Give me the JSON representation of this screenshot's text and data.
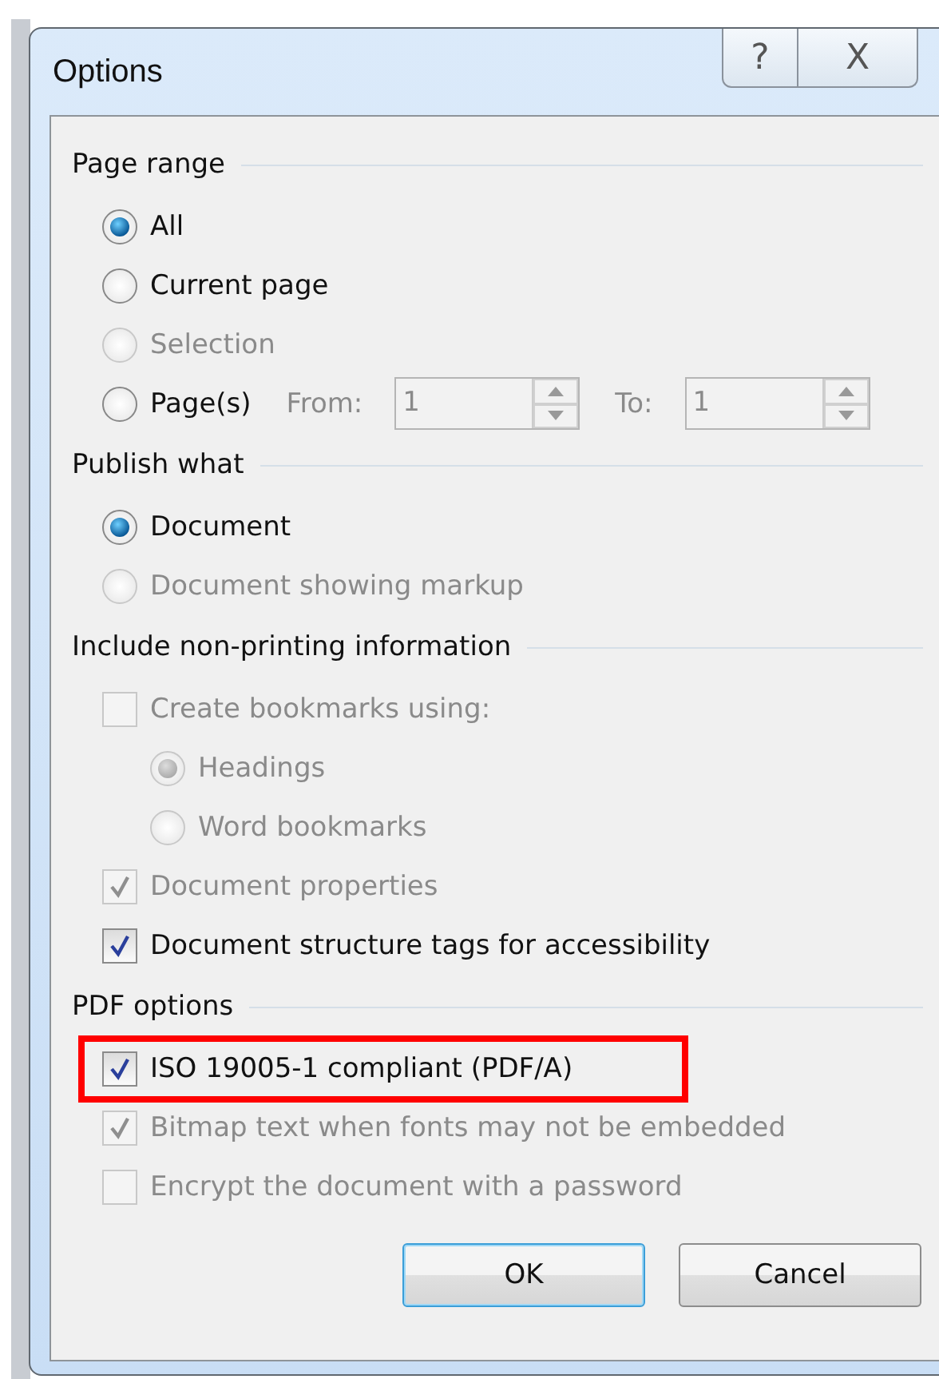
{
  "window": {
    "title": "Options",
    "caption_buttons": [
      "?",
      "X"
    ]
  },
  "sections": [
    {
      "title": "Page range",
      "items": [
        {
          "kind": "radio",
          "label": "All",
          "selected": true,
          "disabled": false
        },
        {
          "kind": "radio",
          "label": "Current page",
          "selected": false,
          "disabled": false
        },
        {
          "kind": "radio",
          "label": "Selection",
          "selected": false,
          "disabled": true
        },
        {
          "kind": "pages",
          "label": "Page(s)",
          "selected": false,
          "disabled": false,
          "from_label": "From:",
          "from_value": "1",
          "to_label": "To:",
          "to_value": "1"
        }
      ]
    },
    {
      "title": "Publish what",
      "items": [
        {
          "kind": "radio",
          "label": "Document",
          "selected": true,
          "disabled": false
        },
        {
          "kind": "radio",
          "label": "Document showing markup",
          "selected": false,
          "disabled": true
        }
      ]
    },
    {
      "title": "Include non-printing information",
      "items": [
        {
          "kind": "checkbox",
          "label": "Create bookmarks using:",
          "checked": false,
          "disabled": true,
          "children": [
            {
              "kind": "radio",
              "label": "Headings",
              "selected": true,
              "disabled": true
            },
            {
              "kind": "radio",
              "label": "Word bookmarks",
              "selected": false,
              "disabled": true
            }
          ]
        },
        {
          "kind": "checkbox",
          "label": "Document properties",
          "checked": true,
          "disabled": true
        },
        {
          "kind": "checkbox",
          "label": "Document structure tags for accessibility",
          "checked": true,
          "disabled": false
        }
      ]
    },
    {
      "title": "PDF options",
      "items": [
        {
          "kind": "checkbox",
          "label": "ISO 19005-1 compliant (PDF/A)",
          "checked": true,
          "disabled": false,
          "highlighted": true
        },
        {
          "kind": "checkbox",
          "label": "Bitmap text when fonts may not be embedded",
          "checked": true,
          "disabled": true
        },
        {
          "kind": "checkbox",
          "label": "Encrypt the document with a password",
          "checked": false,
          "disabled": true
        }
      ]
    }
  ],
  "buttons": [
    {
      "label": "OK",
      "default": true
    },
    {
      "label": "Cancel",
      "default": false
    }
  ]
}
